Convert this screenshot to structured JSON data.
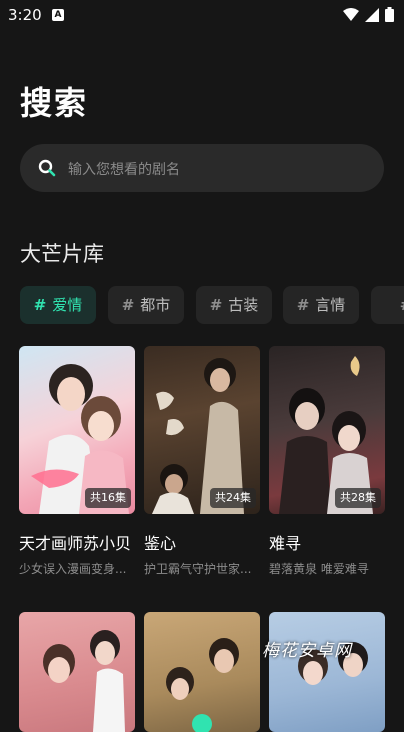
{
  "status_bar": {
    "time": "3:20",
    "app_icon": "A"
  },
  "page": {
    "title": "搜索"
  },
  "search": {
    "placeholder": "输入您想看的剧名",
    "icon": "search-icon"
  },
  "section": {
    "title": "大芒片库"
  },
  "tags": [
    {
      "label": "爱情",
      "active": true
    },
    {
      "label": "都市",
      "active": false
    },
    {
      "label": "古装",
      "active": false
    },
    {
      "label": "言情",
      "active": false
    },
    {
      "label": "",
      "active": false
    }
  ],
  "cards": [
    {
      "title": "天才画师苏小贝",
      "desc": "少女误入漫画变身...",
      "episodes": "共16集"
    },
    {
      "title": "鉴心",
      "desc": "护卫霸气守护世家...",
      "episodes": "共24集"
    },
    {
      "title": "难寻",
      "desc": "碧落黄泉 唯爱难寻",
      "episodes": "共28集"
    }
  ],
  "watermark": "梅花安卓网",
  "colors": {
    "accent": "#30e3b0",
    "background": "#161616"
  }
}
